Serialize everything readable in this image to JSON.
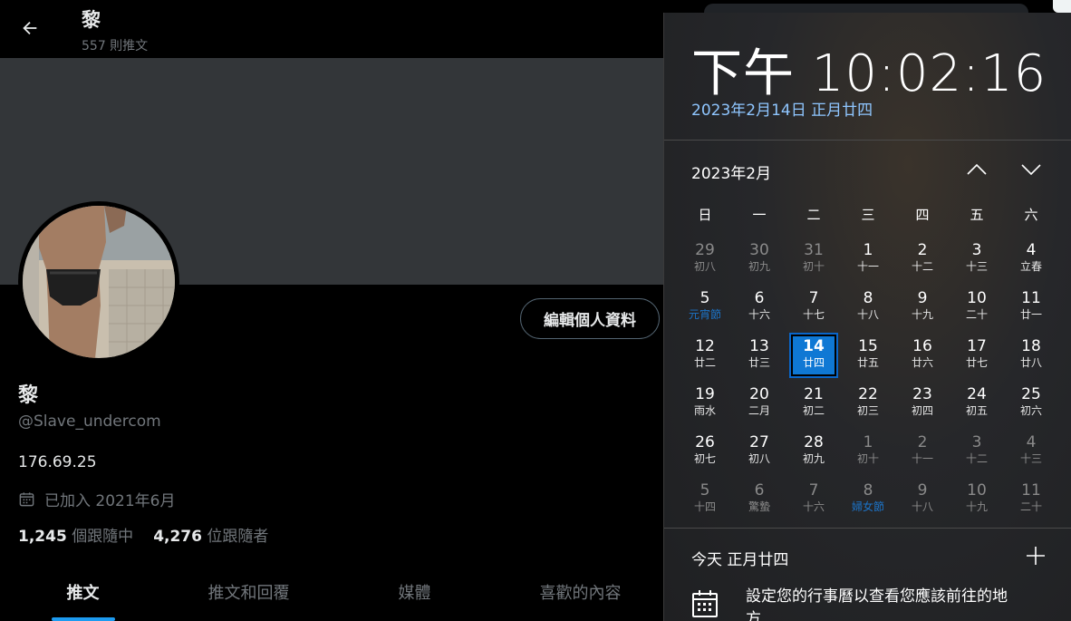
{
  "twitter": {
    "header": {
      "name": "黎",
      "tweet_count": "557 則推文"
    },
    "profile": {
      "name": "黎",
      "handle": "@Slave_undercom",
      "bio": "176.69.25",
      "joined": "已加入 2021年6月",
      "following_count": "1,245",
      "following_label": "個跟隨中",
      "followers_count": "4,276",
      "followers_label": "位跟隨者",
      "edit_button": "編輯個人資料"
    },
    "tabs": [
      {
        "label": "推文",
        "active": true
      },
      {
        "label": "推文和回覆",
        "active": false
      },
      {
        "label": "媒體",
        "active": false
      },
      {
        "label": "喜歡的內容",
        "active": false
      }
    ],
    "colors": {
      "accent": "#1d9bf0",
      "banner": "#333639"
    }
  },
  "calendar": {
    "time": "下午 10:02:16",
    "date_link": "2023年2月14日 正月廿四",
    "month_title": "2023年2月",
    "weekdays": [
      "日",
      "一",
      "二",
      "三",
      "四",
      "五",
      "六"
    ],
    "days": [
      {
        "d": "29",
        "l": "初八",
        "other": true
      },
      {
        "d": "30",
        "l": "初九",
        "other": true
      },
      {
        "d": "31",
        "l": "初十",
        "other": true
      },
      {
        "d": "1",
        "l": "十一"
      },
      {
        "d": "2",
        "l": "十二"
      },
      {
        "d": "3",
        "l": "十三"
      },
      {
        "d": "4",
        "l": "立春"
      },
      {
        "d": "5",
        "l": "元宵節",
        "holiday": true
      },
      {
        "d": "6",
        "l": "十六"
      },
      {
        "d": "7",
        "l": "十七"
      },
      {
        "d": "8",
        "l": "十八"
      },
      {
        "d": "9",
        "l": "十九"
      },
      {
        "d": "10",
        "l": "二十"
      },
      {
        "d": "11",
        "l": "廿一"
      },
      {
        "d": "12",
        "l": "廿二"
      },
      {
        "d": "13",
        "l": "廿三"
      },
      {
        "d": "14",
        "l": "廿四",
        "today": true
      },
      {
        "d": "15",
        "l": "廿五"
      },
      {
        "d": "16",
        "l": "廿六"
      },
      {
        "d": "17",
        "l": "廿七"
      },
      {
        "d": "18",
        "l": "廿八"
      },
      {
        "d": "19",
        "l": "雨水"
      },
      {
        "d": "20",
        "l": "二月"
      },
      {
        "d": "21",
        "l": "初二"
      },
      {
        "d": "22",
        "l": "初三"
      },
      {
        "d": "23",
        "l": "初四"
      },
      {
        "d": "24",
        "l": "初五"
      },
      {
        "d": "25",
        "l": "初六"
      },
      {
        "d": "26",
        "l": "初七"
      },
      {
        "d": "27",
        "l": "初八"
      },
      {
        "d": "28",
        "l": "初九"
      },
      {
        "d": "1",
        "l": "初十",
        "other": true
      },
      {
        "d": "2",
        "l": "十一",
        "other": true
      },
      {
        "d": "3",
        "l": "十二",
        "other": true
      },
      {
        "d": "4",
        "l": "十三",
        "other": true
      },
      {
        "d": "5",
        "l": "十四",
        "other": true
      },
      {
        "d": "6",
        "l": "驚蟄",
        "other": true
      },
      {
        "d": "7",
        "l": "十六",
        "other": true
      },
      {
        "d": "8",
        "l": "婦女節",
        "other": true,
        "holiday": true
      },
      {
        "d": "9",
        "l": "十八",
        "other": true
      },
      {
        "d": "10",
        "l": "十九",
        "other": true
      },
      {
        "d": "11",
        "l": "二十",
        "other": true
      }
    ],
    "today_label": "今天 正月廿四",
    "event_text": "設定您的行事曆以查看您應該前往的地方",
    "colors": {
      "today": "#0f78d4",
      "link": "#8fc6ff",
      "holiday": "#1c74c8"
    }
  }
}
